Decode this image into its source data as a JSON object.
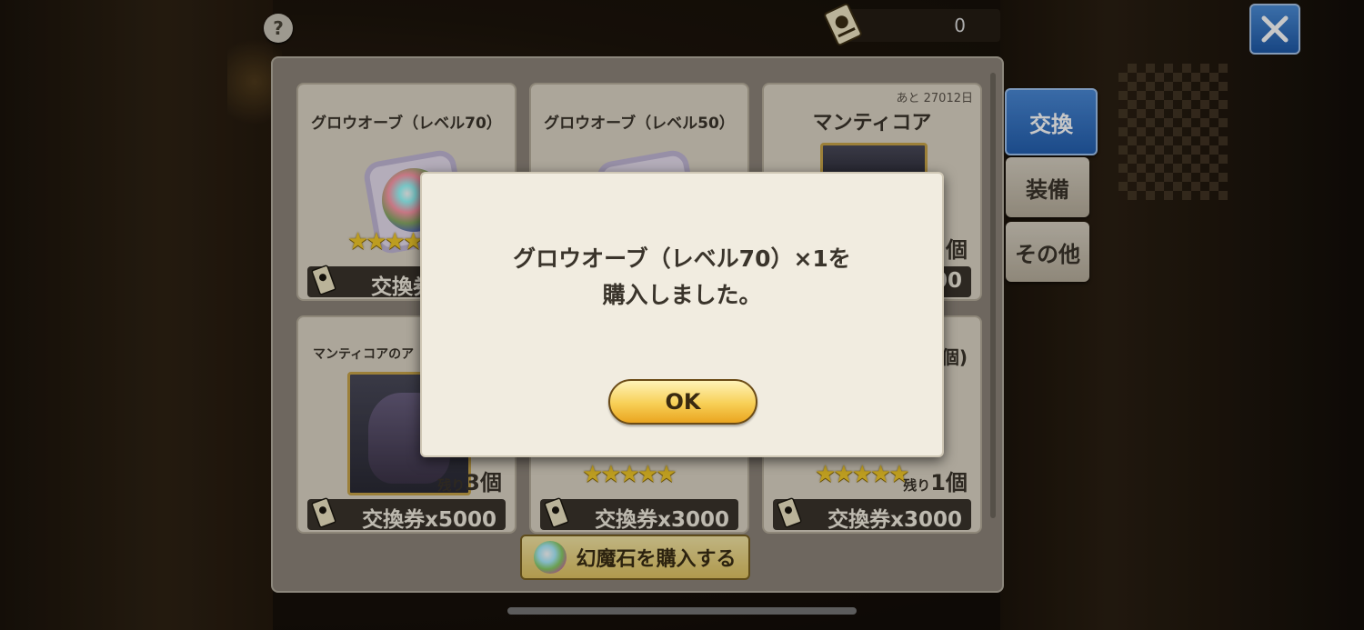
{
  "header": {
    "currency_value": "0"
  },
  "tabs": [
    {
      "label": "交換",
      "active": true
    },
    {
      "label": "装備",
      "active": false
    },
    {
      "label": "その他",
      "active": false
    }
  ],
  "items": [
    {
      "title": "グロウオーブ（レベル70）",
      "price": "交換券",
      "stars": "★★★★★"
    },
    {
      "title": "グロウオーブ（レベル50）"
    },
    {
      "title": "マンティコア",
      "days_left": "あと 27012日",
      "stock": "個",
      "price": "00"
    },
    {
      "title": "マンティコアのア",
      "stock_prefix": "残り",
      "stock": "3個",
      "price": "交換券x5000"
    },
    {
      "price": "交換券x3000",
      "stars": "★★★★★"
    },
    {
      "title": "個)",
      "stock_prefix": "残り",
      "stock": "1個",
      "price": "交換券x3000",
      "stars": "★★★★★"
    }
  ],
  "buy_button": {
    "label": "幻魔石を購入する"
  },
  "dialog": {
    "line1": "グロウオーブ（レベル70）×1を",
    "line2": "購入しました。",
    "ok_label": "OK"
  },
  "colors": {
    "accent_blue": "#2460b0",
    "gold": "#f7cf55",
    "star": "#f3c92a"
  }
}
